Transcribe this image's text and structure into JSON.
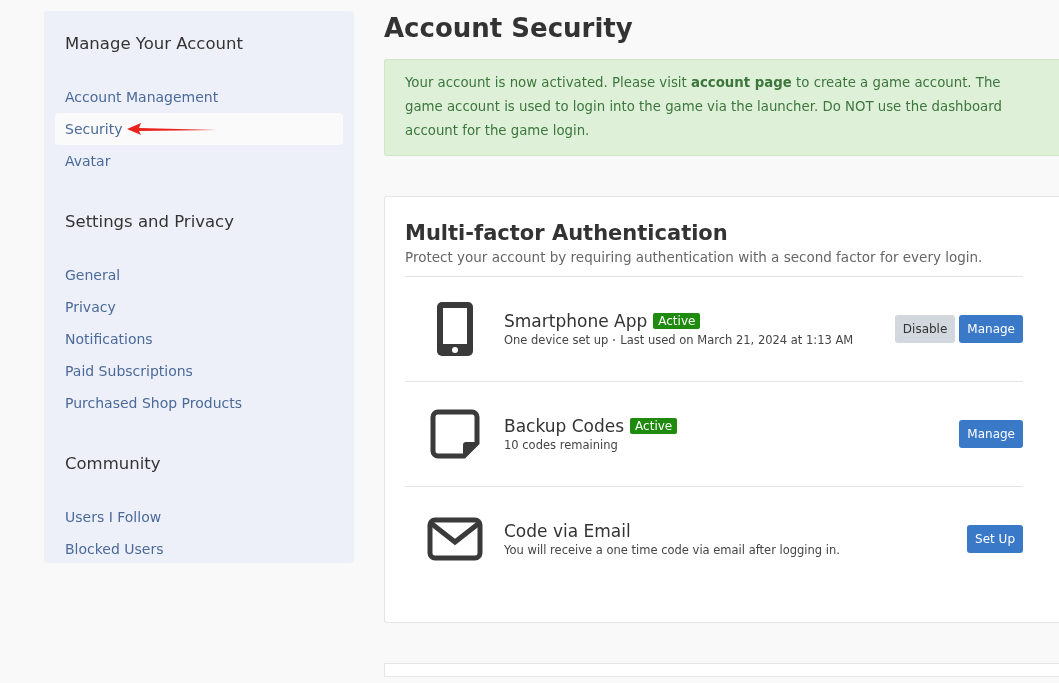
{
  "sidebar": {
    "sections": [
      {
        "title": "Manage Your Account",
        "items": [
          {
            "label": "Account Management",
            "selected": false,
            "annotated": false
          },
          {
            "label": "Security",
            "selected": true,
            "annotated": true
          },
          {
            "label": "Avatar",
            "selected": false,
            "annotated": false
          }
        ]
      },
      {
        "title": "Settings and Privacy",
        "items": [
          {
            "label": "General",
            "selected": false,
            "annotated": false
          },
          {
            "label": "Privacy",
            "selected": false,
            "annotated": false
          },
          {
            "label": "Notifications",
            "selected": false,
            "annotated": false
          },
          {
            "label": "Paid Subscriptions",
            "selected": false,
            "annotated": false
          },
          {
            "label": "Purchased Shop Products",
            "selected": false,
            "annotated": false
          }
        ]
      },
      {
        "title": "Community",
        "items": [
          {
            "label": "Users I Follow",
            "selected": false,
            "annotated": false
          },
          {
            "label": "Blocked Users",
            "selected": false,
            "annotated": false
          }
        ]
      }
    ]
  },
  "page_title": "Account Security",
  "alert": "Your account is now activated. Please visit **account page** to create a game account. The game account is used to login into the game via the launcher. Do NOT use the dashboard account for the game login.",
  "mfa": {
    "title": "Multi-factor Authentication",
    "subtitle": "Protect your account by requiring authentication with a second factor for every login.",
    "methods": [
      {
        "kind": "phone",
        "name": "Smartphone App",
        "badge": "Active",
        "details": [
          "One device set up",
          "Last used on March 21, 2024 at 1:13 AM"
        ],
        "buttons": [
          {
            "label": "Disable",
            "kind": "secondary"
          },
          {
            "label": "Manage",
            "kind": "primary"
          }
        ]
      },
      {
        "kind": "note",
        "name": "Backup Codes",
        "badge": "Active",
        "details": [
          "10 codes remaining"
        ],
        "buttons": [
          {
            "label": "Manage",
            "kind": "primary"
          }
        ]
      },
      {
        "kind": "mail",
        "name": "Code via Email",
        "details": [
          "You will receive a one time code via email after logging in."
        ],
        "buttons": [
          {
            "label": "Set Up",
            "kind": "primary"
          }
        ]
      }
    ]
  }
}
